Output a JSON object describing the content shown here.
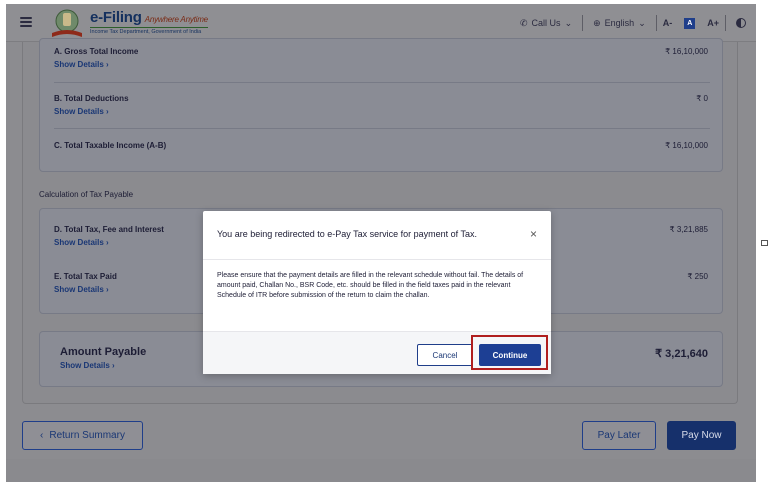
{
  "header": {
    "brand_title": "e-Filing",
    "brand_tagline": "Anywhere Anytime",
    "brand_sub": "Income Tax Department, Government of India",
    "call_us": "Call Us",
    "language": "English",
    "font_decrease": "A-",
    "font_normal": "A",
    "font_increase": "A+"
  },
  "income": {
    "rows": [
      {
        "label": "A. Gross Total Income",
        "link": "Show Details",
        "value": "₹ 16,10,000"
      },
      {
        "label": "B. Total Deductions",
        "link": "Show Details",
        "value": "₹ 0"
      },
      {
        "label": "C. Total Taxable Income (A-B)",
        "link": "",
        "value": "₹ 16,10,000"
      }
    ]
  },
  "tax_section_title": "Calculation of Tax Payable",
  "tax": {
    "rows": [
      {
        "label": "D. Total Tax, Fee and Interest",
        "link": "Show Details",
        "value": "₹ 3,21,885"
      },
      {
        "label": "E. Total Tax Paid",
        "link": "Show Details",
        "value": "₹ 250"
      }
    ]
  },
  "amount_payable": {
    "label": "Amount Payable",
    "link": "Show Details",
    "value": "₹ 3,21,640"
  },
  "footer": {
    "return_summary": "Return Summary",
    "pay_later": "Pay Later",
    "pay_now": "Pay Now"
  },
  "modal": {
    "title": "You are being redirected to e-Pay Tax service for payment of Tax.",
    "body": "Please ensure that the payment details are filled in the relevant schedule without fail. The details of amount paid, Challan No., BSR Code, etc. should be filled in the field taxes paid in the relevant Schedule of ITR before submission of the return to claim the challan.",
    "cancel": "Cancel",
    "continue": "Continue"
  },
  "colors": {
    "primary": "#1d3f94",
    "highlight": "#b01e1e",
    "overlay": "#8c8c90"
  }
}
